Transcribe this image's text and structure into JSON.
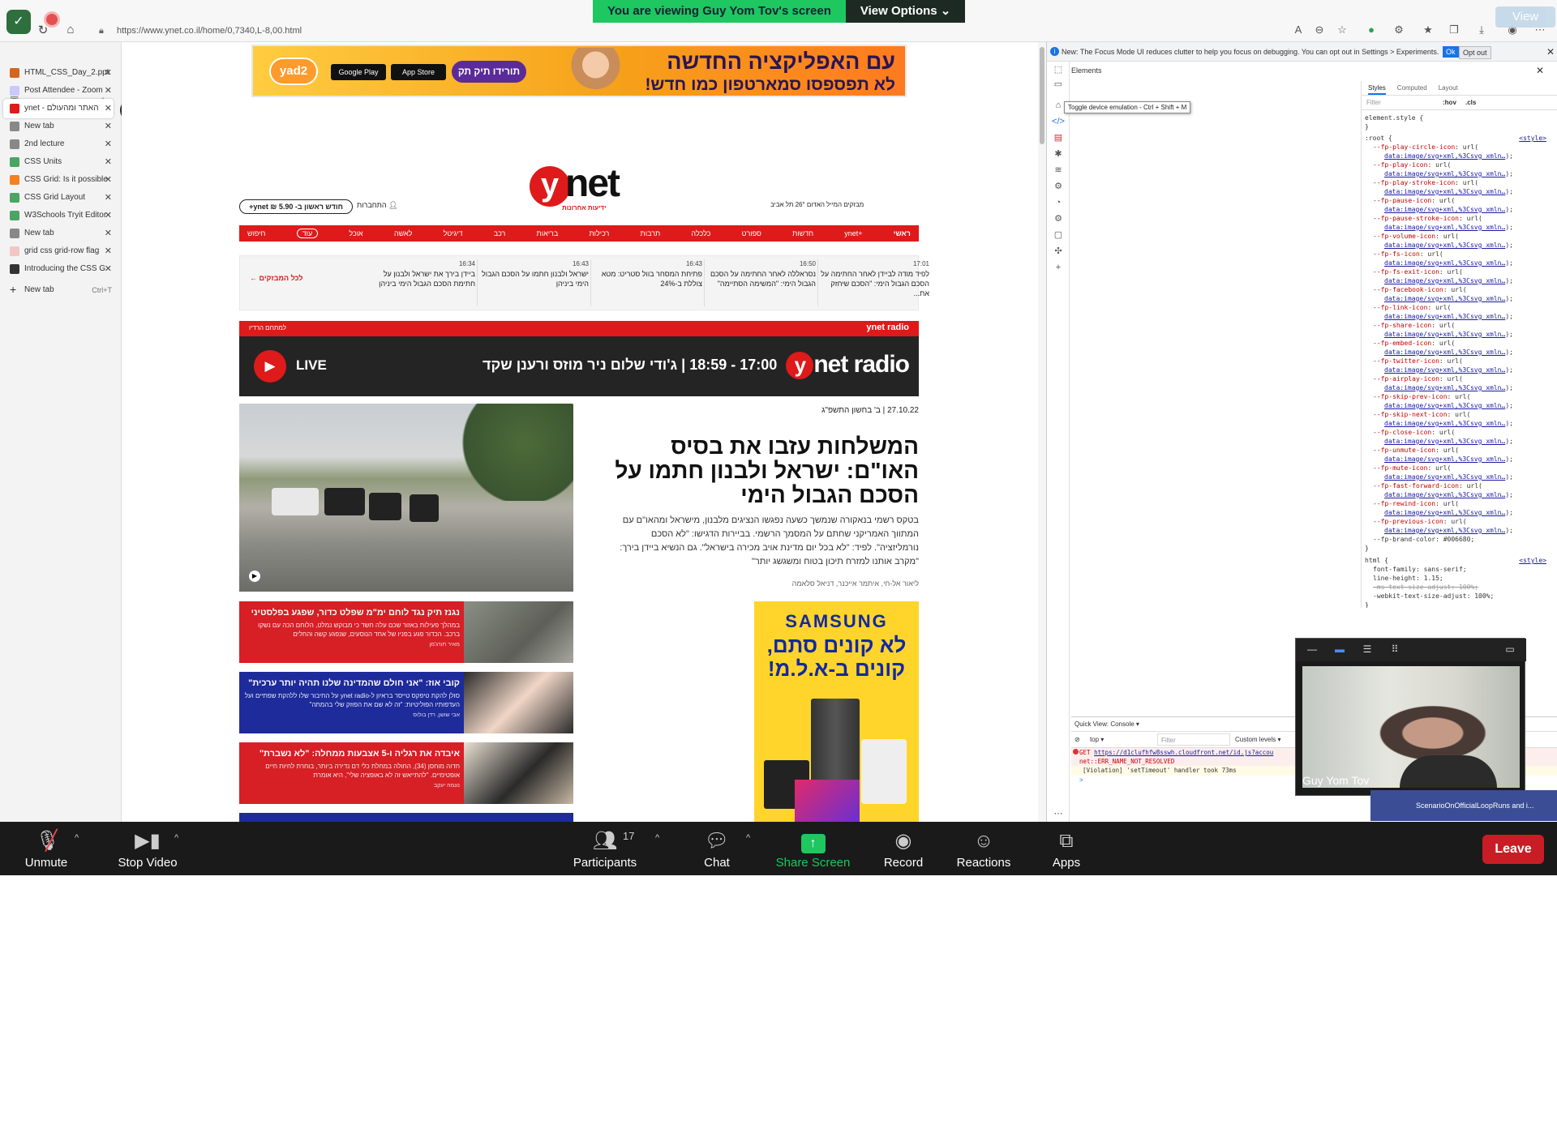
{
  "share_banner": {
    "message": "You are viewing Guy Yom Tov's screen",
    "options": "View Options ⌄"
  },
  "browser": {
    "url": "https://www.ynet.co.il/home/0,7340,L-8,00.html",
    "view_ghost": "View",
    "tabs": [
      {
        "label": "HTML_CSS_Day_2.ppt",
        "color": "#d4651f",
        "active": false
      },
      {
        "label": "Post Attendee - Zoom",
        "color": "#c9c9ff",
        "active": false
      },
      {
        "label": "ynet - האתר ומהעולם",
        "color": "#de1a1a",
        "active": true
      },
      {
        "label": "New tab",
        "color": "#888",
        "active": false
      },
      {
        "label": "2nd lecture",
        "color": "#888",
        "active": false
      },
      {
        "label": "CSS Units",
        "color": "#4aa564",
        "active": false
      },
      {
        "label": "CSS Grid: Is it possible",
        "color": "#f48024",
        "active": false
      },
      {
        "label": "CSS Grid Layout",
        "color": "#4aa564",
        "active": false
      },
      {
        "label": "W3Schools Tryit Editor",
        "color": "#4aa564",
        "active": false
      },
      {
        "label": "New tab",
        "color": "#888",
        "active": false
      },
      {
        "label": "grid css grid-row flag",
        "color": "#f3c6c6",
        "active": false
      },
      {
        "label": "Introducing the CSS G",
        "color": "#333",
        "active": false
      }
    ],
    "new_tab": {
      "label": "New tab",
      "shortcut": "Ctrl+T"
    }
  },
  "ynet": {
    "ad_top": {
      "headline": "עם האפליקציה החדשה",
      "subline": "לא תפספסו סמארטפון כמו חדש!",
      "brand": "yad2",
      "cta": "תורידו תיק תק",
      "store1": "Google Play",
      "store2": "App Store"
    },
    "logo": {
      "letter": "y",
      "text": "net",
      "sub": "ידיעות אחרונות"
    },
    "promo": "חודש ראשון ב- 5.90 ₪ ynet+",
    "login": "התחברות",
    "weather": "מבזקים   המייל האדום   26° תל אביב",
    "nav": [
      "ראשי",
      "ynet+",
      "חדשות",
      "ספורט",
      "כלכלה",
      "תרבות",
      "רכילות",
      "בריאות",
      "רכב",
      "דיגיטל",
      "לאשה",
      "אוכל",
      "עוד",
      "חיפוש"
    ],
    "flash": [
      {
        "time": "17:01",
        "text": "לפיד מודה לביידן לאחר החתימה על הסכם הגבול הימי: \"הסכם שיחזק את..."
      },
      {
        "time": "16:50",
        "text": "נסראללה לאחר החתימה על הסכם הגבול הימי: \"המשימה הסתיימה\""
      },
      {
        "time": "16:43",
        "text": "פתיחת המסחר בוול סטריט: מטא צוללת ב-24%"
      },
      {
        "time": "16:43",
        "text": "ישראל ולבנון חתמו על הסכם הגבול הימי ביניהן"
      },
      {
        "time": "16:34",
        "text": "ביידן בירך את ישראל ולבנון על חתימת הסכם הגבול הימי ביניהן"
      }
    ],
    "flash_all": "לכל המבזקים",
    "radio_head": {
      "brand": "ynet radio",
      "link": "למתחם הרדיו"
    },
    "radio": {
      "live": "LIVE",
      "show": "17:00 - 18:59 | ג'ודי שלום ניר מוזס ורענן שקד",
      "brand_letter": "y",
      "brand": "net radio"
    },
    "date": "27.10.22  |  ב' בחשון התשפ\"ג",
    "headline": "המשלחות עזבו את בסיס האו\"ם: ישראל ולבנון חתמו על הסכם הגבול הימי",
    "lead": "בטקס רשמי בנאקורה שנמשך כשעה נפגשו הנציגים מלבנון, מישראל ומהאו\"ם עם המתווך האמריקני שחתם על המסמך הרשמי. בביירות הדגישו: \"לא הסכם נורמליזציה\". לפיד: \"לא בכל יום מדינת אויב מכירה בישראל\". גם הנשיא ביידן בירך: \"מקרב אותנו למזרח תיכון בטוח ומשגשג יותר\"",
    "byline": "ליאור אל-חי, איתמר אייכנר, דניאל סלאמה",
    "stories": [
      {
        "title": "נגנז תיק נגד לוחם ימ\"מ שפלט כדור, שפגע בפלסטיני",
        "text": "במהלך פעילות באזור שכם עלה חשד כי מבוקש נמלט, הלוחם הכה עם נשקו ברכב. הכדור פגע בפניו של אחד הנוסעים, שנפגע קשה והחלים",
        "author": "מאיר תורג'מן",
        "bg": "#d71f26"
      },
      {
        "title": "קובי אוז: \"אני חולם שהמדינה שלנו תהיה יותר ערכית\"",
        "text": "סולן להקת טיפקס טייסר בראיון ל-ynet radio על החיבור שלו ללהקת שפתיים ועל העדפותיו הפוליטיות: \"זה לא שם את הפוזק שלי בהמתה\"",
        "author": "אבי שושן, רדן בולוס",
        "bg": "#1e2b9b"
      },
      {
        "title": "איבדה את רגליה ו-5 אצבעות ממחלה: \"לא נשברת\"",
        "text": "חדוה מוחסן (34), החולה במחלת כלי דם נדירה ביותר, בוחרת לחיות חיים אופטימיים. \"להתייאש זה לא באופציה שלי\", היא אומרת",
        "author": "נעמה יעקב",
        "bg": "#d71f26"
      }
    ],
    "samsung": {
      "brand": "SAMSUNG",
      "text": "לא קונים סתם, קונים ב-א.ל.מ!"
    }
  },
  "devtools": {
    "info": "New: The Focus Mode UI reduces clutter to help you focus on debugging. You can opt out in Settings > Experiments.",
    "ok": "Ok",
    "opt_out": "Opt out",
    "panel": "Elements",
    "tooltip": "Toggle device emulation - Ctrl + Shift + M",
    "styles_tabs": [
      "Styles",
      "Computed",
      "Layout"
    ],
    "filter": "Filter",
    "hov": ":hov",
    "cls": ".cls",
    "element_style": "element.style {",
    "root_selector": ":root {",
    "style_link": "<style>",
    "vars": [
      "--fp-play-circle-icon",
      "--fp-play-icon",
      "--fp-play-stroke-icon",
      "--fp-pause-icon",
      "--fp-pause-stroke-icon",
      "--fp-volume-icon",
      "--fp-fs-icon",
      "--fp-fs-exit-icon",
      "--fp-facebook-icon",
      "--fp-link-icon",
      "--fp-share-icon",
      "--fp-embed-icon",
      "--fp-twitter-icon",
      "--fp-airplay-icon",
      "--fp-skip-prev-icon",
      "--fp-skip-next-icon",
      "--fp-close-icon",
      "--fp-unmute-icon",
      "--fp-mute-icon",
      "--fp-fast-forward-icon",
      "--fp-rewind-icon",
      "--fp-previous-icon"
    ],
    "var_value": "url(",
    "var_data": "data:image/svg+xml,%3Csvg xmln…",
    "brand_color": "--fp-brand-color: #006680;",
    "html_rule": [
      "html {",
      "font-family: sans-serif;",
      "line-height: 1.15;",
      "-ms-text-size-adjust: 100%;",
      "-webkit-text-size-adjust: 100%;"
    ],
    "console": {
      "quick_view": "Quick View:  Console  ▾",
      "context": "top ▾",
      "filter": "Filter",
      "levels": "Custom levels ▾",
      "error_get": "GET",
      "error_url": "https://d1clufhfw8sswh.cloudfront.net/id.js?accou",
      "error_code": "net::ERR_NAME_NOT_RESOLVED",
      "violation": "[Violation] 'setTimeout' handler took 73ms",
      "prompt": ">"
    }
  },
  "zoom": {
    "video_name": "Guy Yom Tov",
    "scenario": "ScenarioOnOfficialLoopRuns and i...",
    "unmute": "Unmute",
    "stop_video": "Stop Video",
    "participants": "Participants",
    "participant_count": "17",
    "chat": "Chat",
    "share": "Share Screen",
    "record": "Record",
    "reactions": "Reactions",
    "apps": "Apps",
    "leave": "Leave"
  }
}
